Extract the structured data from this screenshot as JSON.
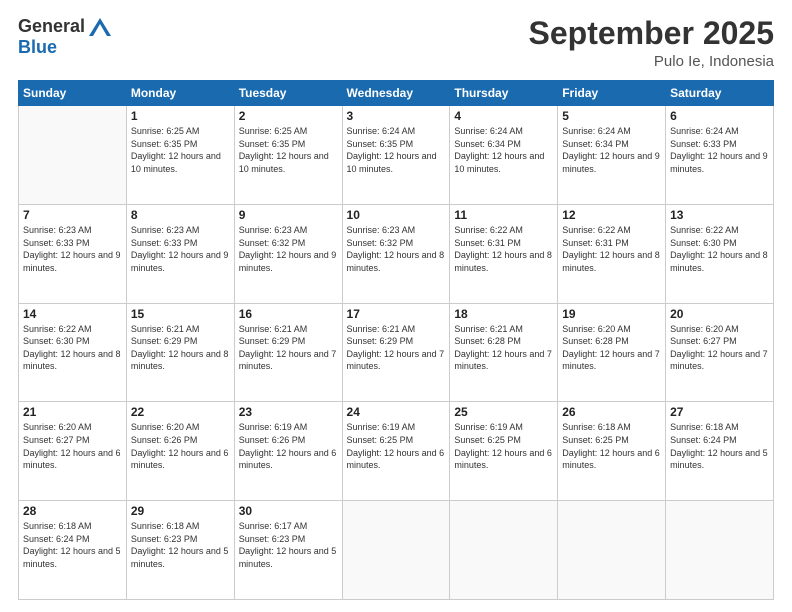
{
  "header": {
    "logo_general": "General",
    "logo_blue": "Blue",
    "title": "September 2025",
    "location": "Pulo Ie, Indonesia"
  },
  "calendar": {
    "days_of_week": [
      "Sunday",
      "Monday",
      "Tuesday",
      "Wednesday",
      "Thursday",
      "Friday",
      "Saturday"
    ],
    "weeks": [
      [
        {
          "day": "",
          "info": ""
        },
        {
          "day": "1",
          "info": "Sunrise: 6:25 AM\nSunset: 6:35 PM\nDaylight: 12 hours\nand 10 minutes."
        },
        {
          "day": "2",
          "info": "Sunrise: 6:25 AM\nSunset: 6:35 PM\nDaylight: 12 hours\nand 10 minutes."
        },
        {
          "day": "3",
          "info": "Sunrise: 6:24 AM\nSunset: 6:35 PM\nDaylight: 12 hours\nand 10 minutes."
        },
        {
          "day": "4",
          "info": "Sunrise: 6:24 AM\nSunset: 6:34 PM\nDaylight: 12 hours\nand 10 minutes."
        },
        {
          "day": "5",
          "info": "Sunrise: 6:24 AM\nSunset: 6:34 PM\nDaylight: 12 hours\nand 9 minutes."
        },
        {
          "day": "6",
          "info": "Sunrise: 6:24 AM\nSunset: 6:33 PM\nDaylight: 12 hours\nand 9 minutes."
        }
      ],
      [
        {
          "day": "7",
          "info": "Sunrise: 6:23 AM\nSunset: 6:33 PM\nDaylight: 12 hours\nand 9 minutes."
        },
        {
          "day": "8",
          "info": "Sunrise: 6:23 AM\nSunset: 6:33 PM\nDaylight: 12 hours\nand 9 minutes."
        },
        {
          "day": "9",
          "info": "Sunrise: 6:23 AM\nSunset: 6:32 PM\nDaylight: 12 hours\nand 9 minutes."
        },
        {
          "day": "10",
          "info": "Sunrise: 6:23 AM\nSunset: 6:32 PM\nDaylight: 12 hours\nand 8 minutes."
        },
        {
          "day": "11",
          "info": "Sunrise: 6:22 AM\nSunset: 6:31 PM\nDaylight: 12 hours\nand 8 minutes."
        },
        {
          "day": "12",
          "info": "Sunrise: 6:22 AM\nSunset: 6:31 PM\nDaylight: 12 hours\nand 8 minutes."
        },
        {
          "day": "13",
          "info": "Sunrise: 6:22 AM\nSunset: 6:30 PM\nDaylight: 12 hours\nand 8 minutes."
        }
      ],
      [
        {
          "day": "14",
          "info": "Sunrise: 6:22 AM\nSunset: 6:30 PM\nDaylight: 12 hours\nand 8 minutes."
        },
        {
          "day": "15",
          "info": "Sunrise: 6:21 AM\nSunset: 6:29 PM\nDaylight: 12 hours\nand 8 minutes."
        },
        {
          "day": "16",
          "info": "Sunrise: 6:21 AM\nSunset: 6:29 PM\nDaylight: 12 hours\nand 7 minutes."
        },
        {
          "day": "17",
          "info": "Sunrise: 6:21 AM\nSunset: 6:29 PM\nDaylight: 12 hours\nand 7 minutes."
        },
        {
          "day": "18",
          "info": "Sunrise: 6:21 AM\nSunset: 6:28 PM\nDaylight: 12 hours\nand 7 minutes."
        },
        {
          "day": "19",
          "info": "Sunrise: 6:20 AM\nSunset: 6:28 PM\nDaylight: 12 hours\nand 7 minutes."
        },
        {
          "day": "20",
          "info": "Sunrise: 6:20 AM\nSunset: 6:27 PM\nDaylight: 12 hours\nand 7 minutes."
        }
      ],
      [
        {
          "day": "21",
          "info": "Sunrise: 6:20 AM\nSunset: 6:27 PM\nDaylight: 12 hours\nand 6 minutes."
        },
        {
          "day": "22",
          "info": "Sunrise: 6:20 AM\nSunset: 6:26 PM\nDaylight: 12 hours\nand 6 minutes."
        },
        {
          "day": "23",
          "info": "Sunrise: 6:19 AM\nSunset: 6:26 PM\nDaylight: 12 hours\nand 6 minutes."
        },
        {
          "day": "24",
          "info": "Sunrise: 6:19 AM\nSunset: 6:25 PM\nDaylight: 12 hours\nand 6 minutes."
        },
        {
          "day": "25",
          "info": "Sunrise: 6:19 AM\nSunset: 6:25 PM\nDaylight: 12 hours\nand 6 minutes."
        },
        {
          "day": "26",
          "info": "Sunrise: 6:18 AM\nSunset: 6:25 PM\nDaylight: 12 hours\nand 6 minutes."
        },
        {
          "day": "27",
          "info": "Sunrise: 6:18 AM\nSunset: 6:24 PM\nDaylight: 12 hours\nand 5 minutes."
        }
      ],
      [
        {
          "day": "28",
          "info": "Sunrise: 6:18 AM\nSunset: 6:24 PM\nDaylight: 12 hours\nand 5 minutes."
        },
        {
          "day": "29",
          "info": "Sunrise: 6:18 AM\nSunset: 6:23 PM\nDaylight: 12 hours\nand 5 minutes."
        },
        {
          "day": "30",
          "info": "Sunrise: 6:17 AM\nSunset: 6:23 PM\nDaylight: 12 hours\nand 5 minutes."
        },
        {
          "day": "",
          "info": ""
        },
        {
          "day": "",
          "info": ""
        },
        {
          "day": "",
          "info": ""
        },
        {
          "day": "",
          "info": ""
        }
      ]
    ]
  }
}
